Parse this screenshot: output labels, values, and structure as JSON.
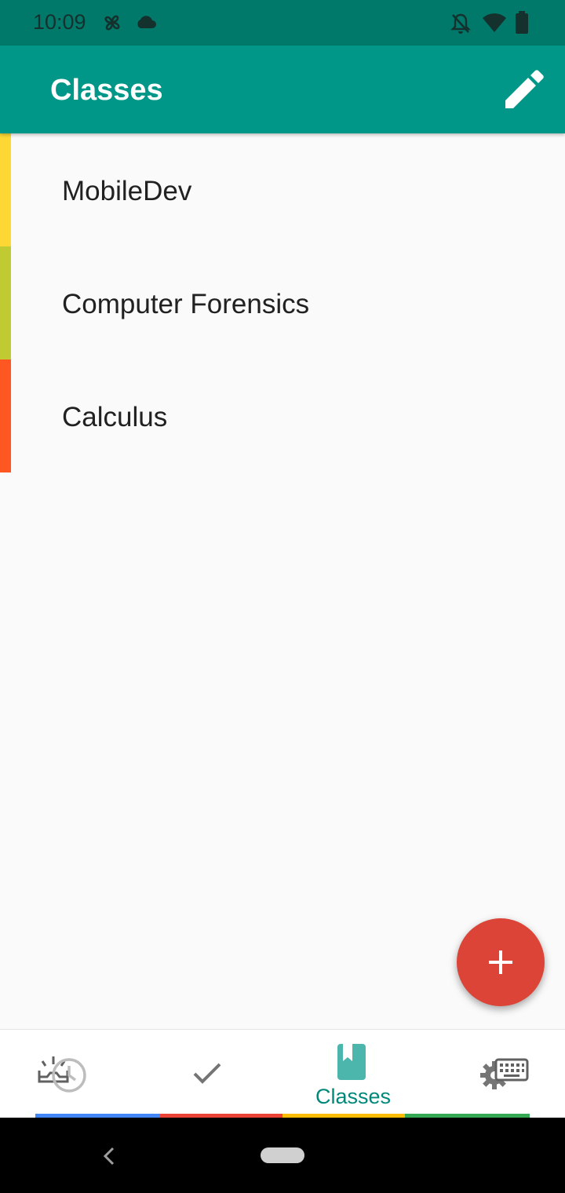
{
  "status_bar": {
    "time": "10:09",
    "icons": [
      "pinwheel-icon",
      "cloud-icon",
      "notifications-off-icon",
      "wifi-icon",
      "battery-icon"
    ]
  },
  "app_bar": {
    "title": "Classes",
    "action_icon": "edit-pencil-icon"
  },
  "classes": [
    {
      "name": "MobileDev",
      "color": "#fdd835"
    },
    {
      "name": "Computer Forensics",
      "color": "#c0ca33"
    },
    {
      "name": "Calculus",
      "color": "#ff5722"
    }
  ],
  "fab": {
    "icon": "plus-icon",
    "color": "#db4437"
  },
  "bottom_nav": {
    "items": [
      {
        "icon": "inbox-history-icon",
        "label": "",
        "active": false
      },
      {
        "icon": "check-icon",
        "label": "",
        "active": false
      },
      {
        "icon": "book-icon",
        "label": "Classes",
        "active": true
      },
      {
        "icon": "settings-keyboard-icon",
        "label": "",
        "active": false
      }
    ],
    "strip_colors": [
      "#4285f4",
      "#ea4335",
      "#fbbc05",
      "#34a853"
    ],
    "active_color": "#00897b"
  },
  "system_nav": {
    "back_icon": "back-chevron-icon",
    "home_icon": "home-pill-icon"
  }
}
